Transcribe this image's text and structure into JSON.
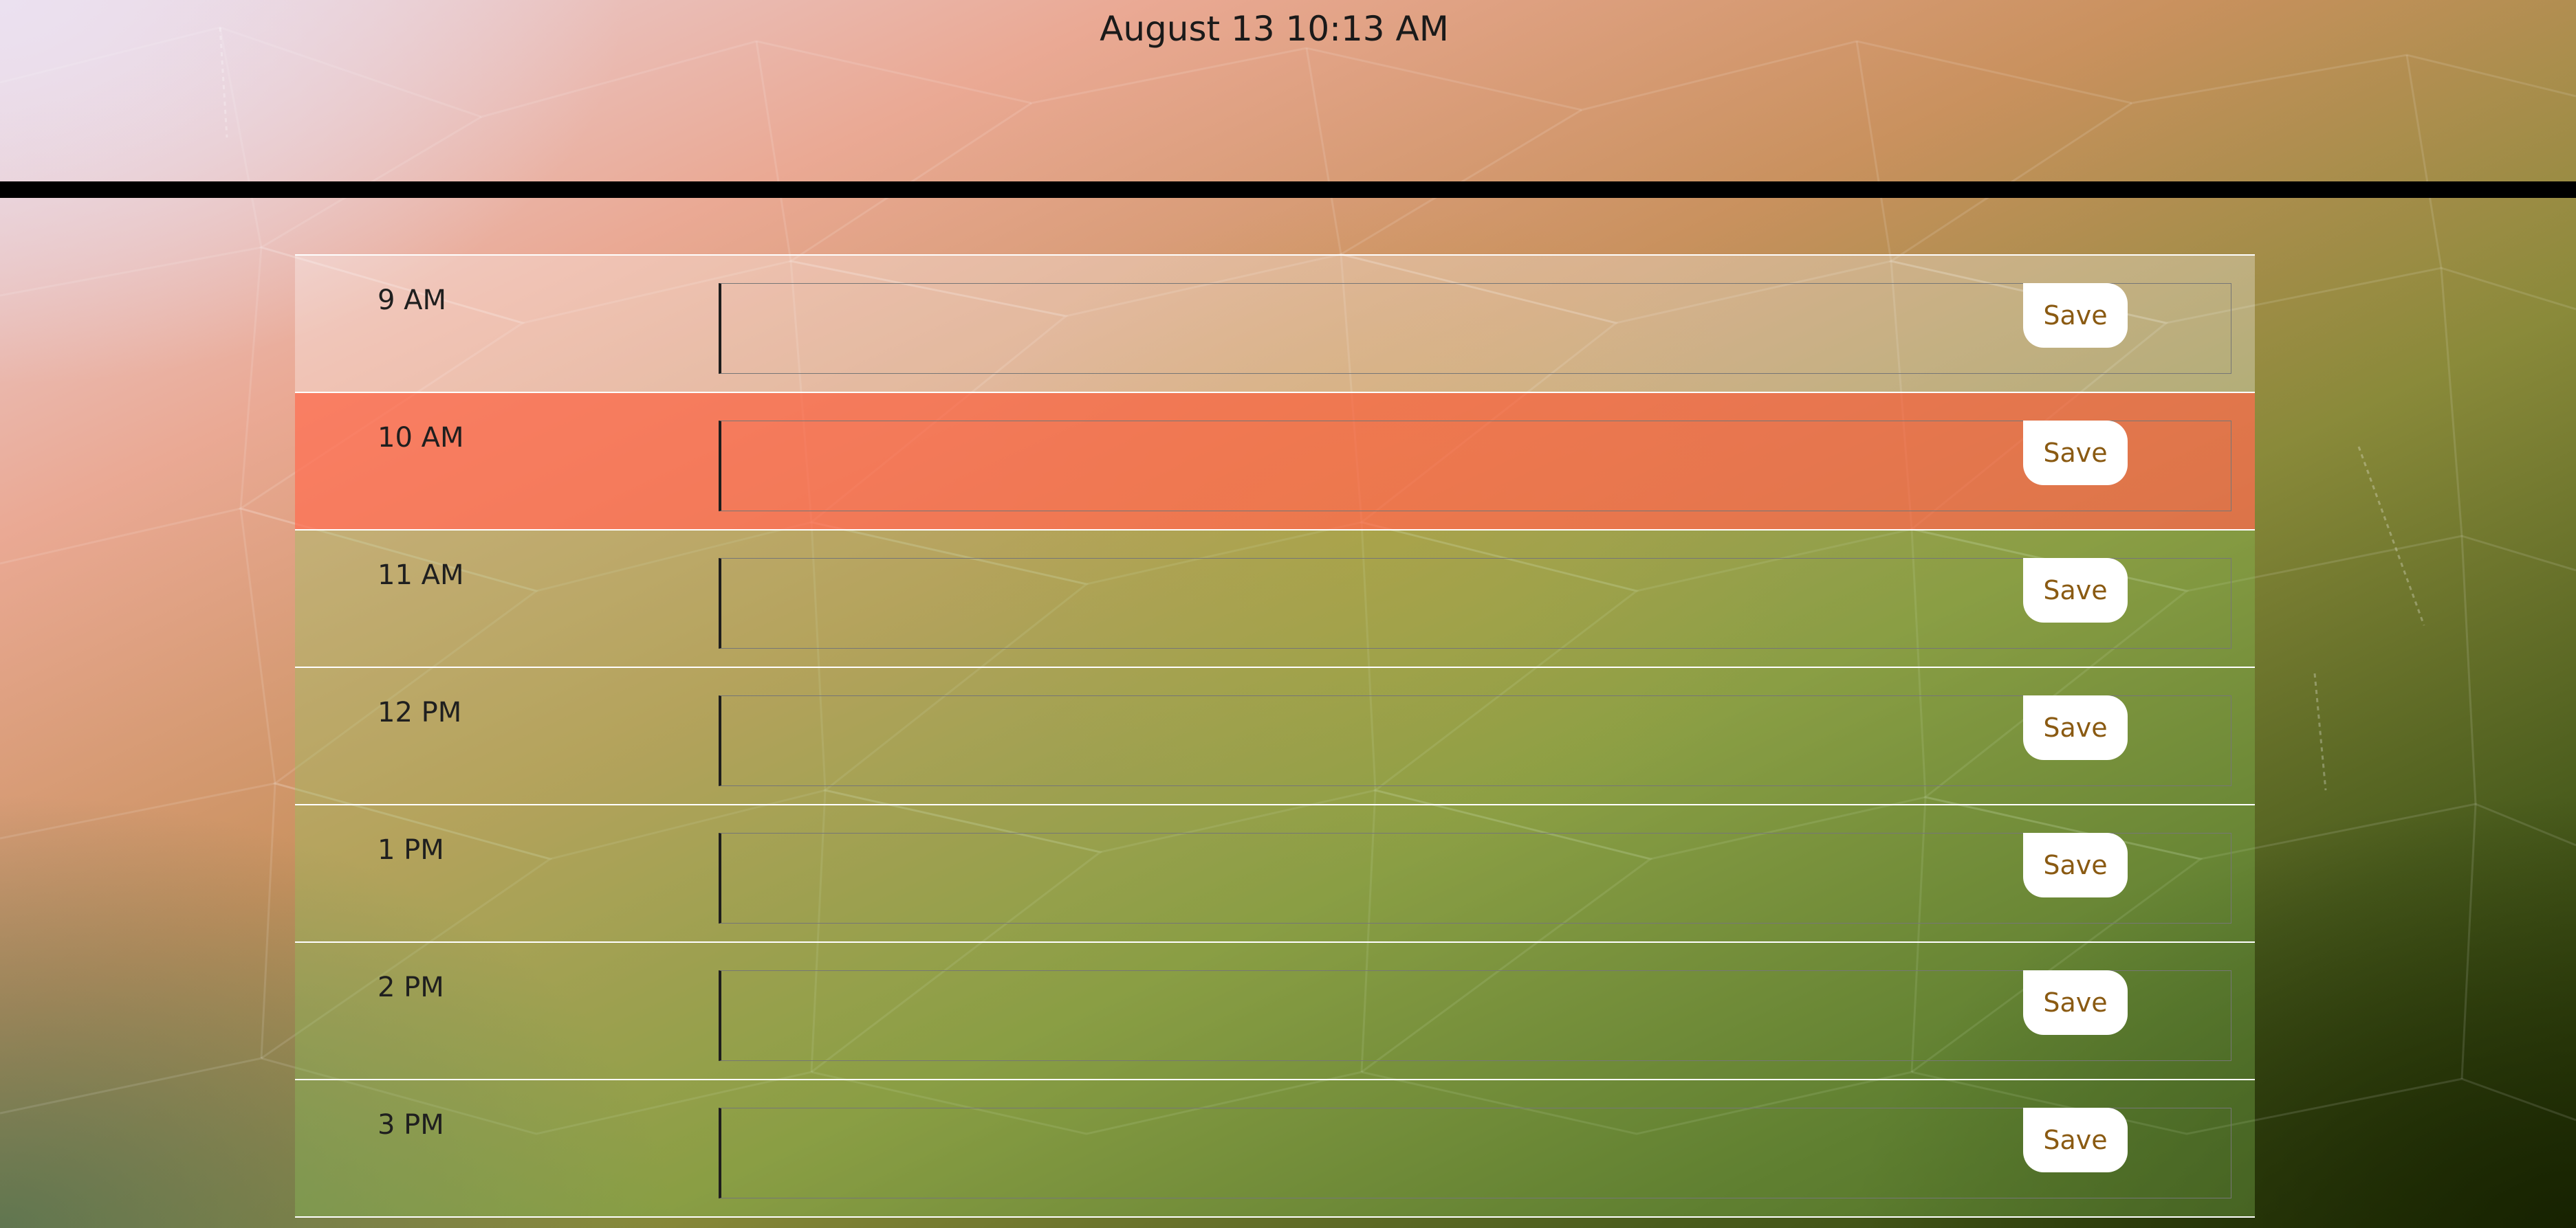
{
  "header": {
    "current_day": "August 13 10:13 AM"
  },
  "colors": {
    "past": "#ffffff",
    "present": "#ff6e50",
    "future": "#8cc85a",
    "save_text": "#8a5a12",
    "divider": "#000000"
  },
  "time_blocks": [
    {
      "hour": "9 AM",
      "state": "past",
      "text": "",
      "save_label": "Save"
    },
    {
      "hour": "10 AM",
      "state": "present",
      "text": "",
      "save_label": "Save"
    },
    {
      "hour": "11 AM",
      "state": "future",
      "text": "",
      "save_label": "Save"
    },
    {
      "hour": "12 PM",
      "state": "future",
      "text": "",
      "save_label": "Save"
    },
    {
      "hour": "1 PM",
      "state": "future",
      "text": "",
      "save_label": "Save"
    },
    {
      "hour": "2 PM",
      "state": "future",
      "text": "",
      "save_label": "Save"
    },
    {
      "hour": "3 PM",
      "state": "future",
      "text": "",
      "save_label": "Save"
    }
  ]
}
